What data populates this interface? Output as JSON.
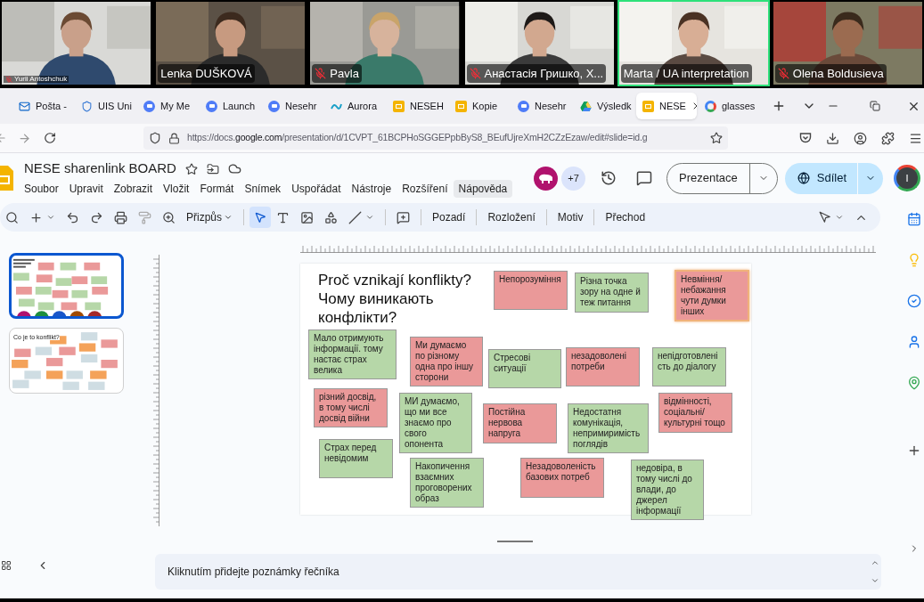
{
  "video_tiles": [
    {
      "name": "Yurii Antoshchuk",
      "kind": "compact",
      "muted": true,
      "speaking": false
    },
    {
      "name": "Lenka DUŠKOVÁ",
      "kind": "standard",
      "muted": false,
      "speaking": false
    },
    {
      "name": "Pavla",
      "kind": "standard",
      "muted": true,
      "speaking": false
    },
    {
      "name": "Анастасія Гришко, Х...",
      "kind": "standard",
      "muted": true,
      "speaking": false
    },
    {
      "name": "Marta / UA interpretation",
      "kind": "standard",
      "muted": false,
      "speaking": true
    },
    {
      "name": "Olena Boldusieva",
      "kind": "standard",
      "muted": true,
      "speaking": false
    }
  ],
  "browser": {
    "tabs": [
      {
        "label": "Pošta -",
        "kind": "mail",
        "selected": false
      },
      {
        "label": "UIS Uni",
        "kind": "shield",
        "selected": false
      },
      {
        "label": "My Me",
        "kind": "zoom",
        "selected": false
      },
      {
        "label": "Launch",
        "kind": "zoom",
        "selected": false
      },
      {
        "label": "Nesehr",
        "kind": "zoom",
        "selected": false
      },
      {
        "label": "Aurora",
        "kind": "aurora",
        "selected": false
      },
      {
        "label": "NESEH",
        "kind": "slides",
        "selected": false
      },
      {
        "label": "Kopie",
        "kind": "slides",
        "selected": false
      },
      {
        "label": "Nesehr",
        "kind": "zoom",
        "selected": false
      },
      {
        "label": "Výsledk",
        "kind": "drive",
        "selected": false
      },
      {
        "label": "NESE",
        "kind": "slides",
        "selected": true
      },
      {
        "label": "glasses",
        "kind": "google",
        "selected": false
      }
    ],
    "url_prefix": "https://docs.",
    "url_domain": "google.com",
    "url_rest": "/presentation/d/1CVPT_61BCPHoSGGEPpbByS8_BEufUjreXmH2CZzEzaw/edit#slide=id.g"
  },
  "document": {
    "title": "NESE sharenlink BOARD",
    "menu": [
      {
        "label": "Soubor",
        "hovered": false
      },
      {
        "label": "Upravit",
        "hovered": false
      },
      {
        "label": "Zobrazit",
        "hovered": false
      },
      {
        "label": "Vložit",
        "hovered": false
      },
      {
        "label": "Formát",
        "hovered": false
      },
      {
        "label": "Snímek",
        "hovered": false
      },
      {
        "label": "Uspořádat",
        "hovered": false
      },
      {
        "label": "Nástroje",
        "hovered": false
      },
      {
        "label": "Rozšíření",
        "hovered": false
      },
      {
        "label": "Nápověda",
        "hovered": true
      }
    ],
    "collaborators_more": "+7",
    "present_button": "Prezentace",
    "share_button": "Sdílet",
    "user_initial": "I"
  },
  "toolbar": {
    "zoom": "Přizpůs",
    "buttons": [
      "Pozadí",
      "Rozložení",
      "Motiv",
      "Přechod"
    ]
  },
  "filmstrip": [
    {
      "selected": true,
      "kind": "notes_board"
    },
    {
      "selected": false,
      "kind": "title_board",
      "title": "Co je to konflikt?"
    }
  ],
  "slide": {
    "title_lines": [
      "Proč vznikají konflikty?",
      "Чому виникають",
      "конфлікти?"
    ],
    "notes": [
      {
        "text": "Непорозуміння",
        "color": "#ea9999",
        "selected": false
      },
      {
        "text": "Різна точка зору на одне й теж питання",
        "color": "#b6d7a8",
        "selected": false
      },
      {
        "text": "Невміння/небажання чути думки інших",
        "color": "#ea9999",
        "selected": true
      },
      {
        "text": "Мало отримують інформації. тому настає страх велика",
        "color": "#b6d7a8",
        "selected": false
      },
      {
        "text": "Ми думаємо по різному одна про іншу сторони",
        "color": "#ea9999",
        "selected": false
      },
      {
        "text": "Стресові ситуації",
        "color": "#b6d7a8",
        "selected": false
      },
      {
        "text": "незадоволені потреби",
        "color": "#ea9999",
        "selected": false
      },
      {
        "text": "непідготовленість до діалогу",
        "color": "#b6d7a8",
        "selected": false
      },
      {
        "text": "різний досвід, в тому числі досвід війни",
        "color": "#ea9999",
        "selected": false
      },
      {
        "text": "МИ думаємо, що ми все знаємо про свого опонента",
        "color": "#b6d7a8",
        "selected": false
      },
      {
        "text": "Постійна нервова напруга",
        "color": "#ea9999",
        "selected": false
      },
      {
        "text": "Недостатня комунікація, непримиримість поглядів",
        "color": "#b6d7a8",
        "selected": false
      },
      {
        "text": "відмінності, соціальні/культурні тощо",
        "color": "#ea9999",
        "selected": false
      },
      {
        "text": "Страх перед невідомим",
        "color": "#b6d7a8",
        "selected": false
      },
      {
        "text": "Накопичення взаємних проговорених образ",
        "color": "#b6d7a8",
        "selected": false
      },
      {
        "text": "Незадоволеність базових потреб",
        "color": "#ea9999",
        "selected": false
      },
      {
        "text": "недовіра, в тому числі до влади, до джерел інформації",
        "color": "#b6d7a8",
        "selected": false
      }
    ]
  },
  "speaker_notes": {
    "placeholder": "Kliknutím přidejte poznámky řečníka"
  }
}
